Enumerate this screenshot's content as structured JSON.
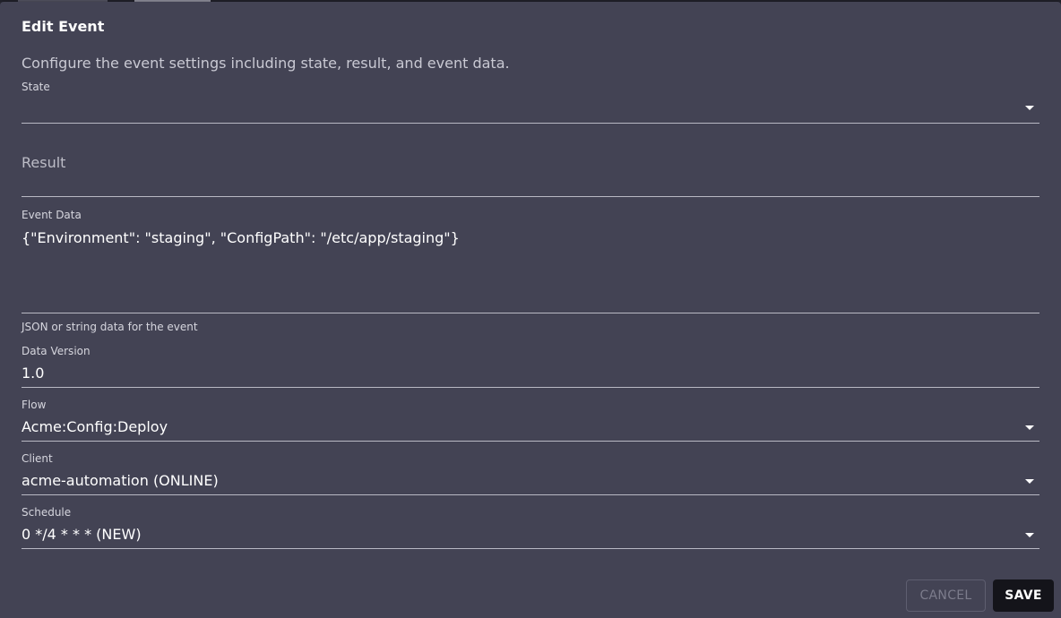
{
  "dialog": {
    "title": "Edit Event",
    "description": "Configure the event settings including state, result, and event data."
  },
  "fields": {
    "state": {
      "label": "State",
      "value": ""
    },
    "result": {
      "label": "Result",
      "value": ""
    },
    "event_data": {
      "label": "Event Data",
      "value": "{\"Environment\": \"staging\", \"ConfigPath\": \"/etc/app/staging\"}",
      "helper": "JSON or string data for the event"
    },
    "data_version": {
      "label": "Data Version",
      "value": "1.0"
    },
    "flow": {
      "label": "Flow",
      "value": "Acme:Config:Deploy"
    },
    "client": {
      "label": "Client",
      "value": "acme-automation (ONLINE)"
    },
    "schedule": {
      "label": "Schedule",
      "value": "0 */4 * * * (NEW)"
    }
  },
  "actions": {
    "cancel_label": "CANCEL",
    "save_label": "SAVE"
  },
  "colors": {
    "dialog_bg": "#434354",
    "save_button_bg": "#14141a",
    "text_primary": "#ffffff"
  }
}
